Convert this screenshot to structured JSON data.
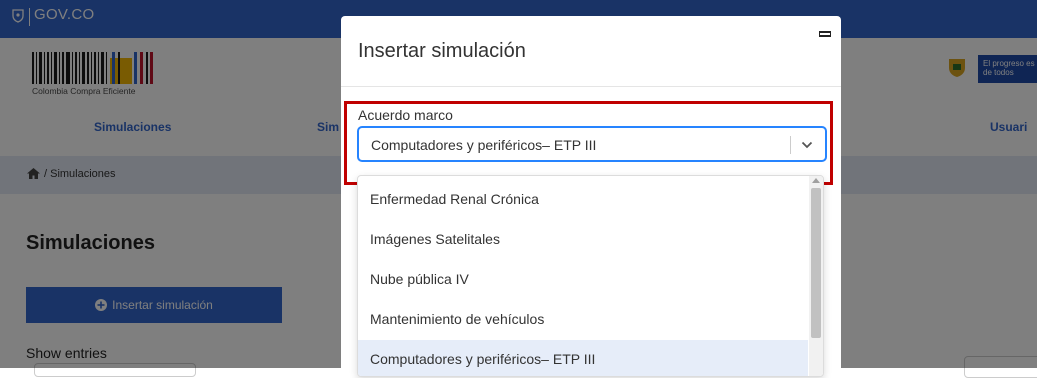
{
  "gov_bar": {
    "label": "GOV.CO",
    "icon": "colombia-shield-icon"
  },
  "header": {
    "logo_text": "Colombia Compra Eficiente",
    "badge_text": "El progreso es de todos",
    "badge_color": "#1f4aa8"
  },
  "nav": {
    "items": [
      {
        "label": "Simulaciones"
      },
      {
        "label": "Sim"
      },
      {
        "label": "Usuari"
      }
    ]
  },
  "breadcrumb": {
    "text": "/ Simulaciones",
    "icon": "home-icon"
  },
  "page": {
    "title": "Simulaciones",
    "insert_button": "Insertar simulación",
    "show_entries": "Show entries"
  },
  "modal": {
    "title": "Insertar simulación",
    "field_label": "Acuerdo marco",
    "selected_value": "Computadores y periféricos– ETP III",
    "options": [
      {
        "label": "Enfermedad Renal Crónica",
        "selected": false
      },
      {
        "label": "Imágenes Satelitales",
        "selected": false
      },
      {
        "label": "Nube pública IV",
        "selected": false
      },
      {
        "label": "Mantenimiento de vehículos",
        "selected": false
      },
      {
        "label": "Computadores y periféricos– ETP III",
        "selected": true
      }
    ]
  },
  "colors": {
    "primary": "#3366cc",
    "highlight": "#c00000",
    "focus": "#2684ff",
    "selected_option_bg": "#e6edf9"
  }
}
